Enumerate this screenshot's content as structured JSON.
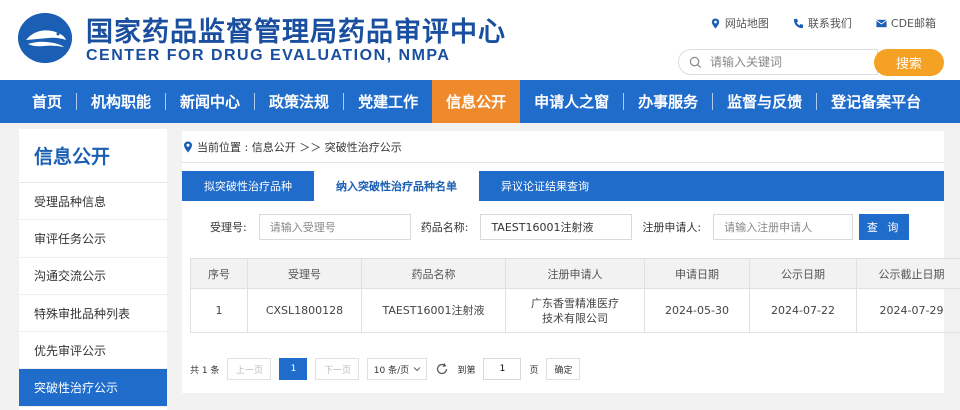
{
  "header": {
    "title_cn": "国家药品监督管理局药品审评中心",
    "title_en": "CENTER FOR DRUG EVALUATION, NMPA",
    "top_links": [
      "网站地图",
      "联系我们",
      "CDE邮箱"
    ],
    "search_placeholder": "请输入关键词",
    "search_button": "搜索",
    "brand_color": "#1f6ccb",
    "accent_color": "#ee8a2c"
  },
  "nav": {
    "items": [
      "首页",
      "机构职能",
      "新闻中心",
      "政策法规",
      "党建工作",
      "信息公开",
      "申请人之窗",
      "办事服务",
      "监督与反馈",
      "登记备案平台"
    ],
    "active": "信息公开"
  },
  "sidebar": {
    "title": "信息公开",
    "items": [
      "受理品种信息",
      "审评任务公示",
      "沟通交流公示",
      "特殊审批品种列表",
      "优先审评公示",
      "突破性治疗公示"
    ],
    "active": "突破性治疗公示"
  },
  "breadcrumb": "当前位置 : 信息公开 ＞＞ 突破性治疗公示",
  "tabs": {
    "items": [
      "拟突破性治疗品种",
      "纳入突破性治疗品种名单",
      "异议论证结果查询"
    ],
    "active": "纳入突破性治疗品种名单"
  },
  "filter": {
    "acceptance_label": "受理号:",
    "acceptance_placeholder": "请输入受理号",
    "drug_label": "药品名称:",
    "drug_value": "TAEST16001注射液",
    "applicant_label": "注册申请人:",
    "applicant_placeholder": "请输入注册申请人",
    "query_button": "查 询"
  },
  "table": {
    "headers": [
      "序号",
      "受理号",
      "药品名称",
      "注册申请人",
      "申请日期",
      "公示日期",
      "公示截止日期"
    ],
    "rows": [
      [
        "1",
        "CXSL1800128",
        "TAEST16001注射液",
        "广东香雪精准医疗技术有限公司",
        "2024-05-30",
        "2024-07-22",
        "2024-07-29"
      ]
    ]
  },
  "pager": {
    "total": "共 1 条",
    "prev": "上一页",
    "current": "1",
    "next": "下一页",
    "page_size": "10 条/页",
    "goto_label": "到第",
    "goto_value": "1",
    "page_unit": "页",
    "confirm": "确定"
  }
}
